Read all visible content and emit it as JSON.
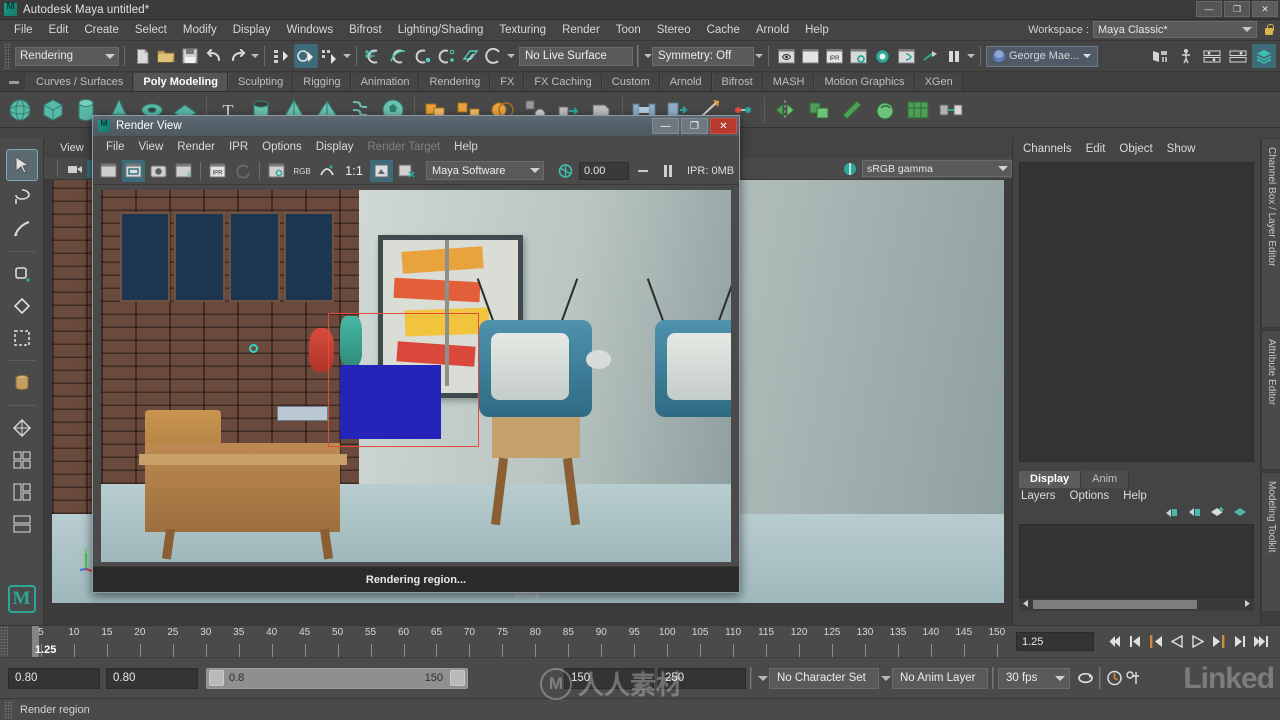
{
  "titlebar": {
    "app_title": "Autodesk Maya  untitled*",
    "logo_icon": "maya-logo-icon",
    "minimize": "—",
    "maximize": "❐",
    "close": "✕"
  },
  "menubar": {
    "items": [
      {
        "label": "File"
      },
      {
        "label": "Edit"
      },
      {
        "label": "Create"
      },
      {
        "label": "Select"
      },
      {
        "label": "Modify"
      },
      {
        "label": "Display"
      },
      {
        "label": "Windows"
      },
      {
        "label": "Bifrost"
      },
      {
        "label": "Lighting/Shading"
      },
      {
        "label": "Texturing"
      },
      {
        "label": "Render"
      },
      {
        "label": "Toon"
      },
      {
        "label": "Stereo"
      },
      {
        "label": "Cache"
      },
      {
        "label": "Arnold"
      },
      {
        "label": "Help"
      }
    ],
    "workspace_label": "Workspace :",
    "workspace_value": "Maya Classic*",
    "lock_icon": "lock-icon"
  },
  "statusbar": {
    "menuset_value": "Rendering",
    "live_surface": "No Live Surface",
    "symmetry": "Symmetry: Off",
    "user_name": "George Mae...",
    "icons": [
      "new-scene-icon",
      "open-scene-icon",
      "save-scene-icon",
      "undo-icon",
      "redo-icon",
      "select-by-hierarchy-icon",
      "select-by-object-icon",
      "select-by-component-icon",
      "snap-to-grid-icon",
      "snap-to-curve-icon",
      "snap-to-point-icon",
      "snap-to-projected-center-icon",
      "snap-to-view-plane-icon",
      "make-live-icon",
      "render-current-frame-icon",
      "render-sequence-icon",
      "ipr-render-icon",
      "render-settings-icon",
      "hypershade-icon",
      "render-setup-icon",
      "light-icon",
      "pause-icon",
      "show-hide-editors-icon",
      "attribute-editor-icon",
      "tool-settings-icon",
      "channel-box-icon"
    ]
  },
  "shelf": {
    "tabs": [
      {
        "label": "Curves / Surfaces",
        "active": false
      },
      {
        "label": "Poly Modeling",
        "active": true
      },
      {
        "label": "Sculpting",
        "active": false
      },
      {
        "label": "Rigging",
        "active": false
      },
      {
        "label": "Animation",
        "active": false
      },
      {
        "label": "Rendering",
        "active": false
      },
      {
        "label": "FX",
        "active": false
      },
      {
        "label": "FX Caching",
        "active": false
      },
      {
        "label": "Custom",
        "active": false
      },
      {
        "label": "Arnold",
        "active": false
      },
      {
        "label": "Bifrost",
        "active": false
      },
      {
        "label": "MASH",
        "active": false
      },
      {
        "label": "Motion Graphics",
        "active": false
      },
      {
        "label": "XGen",
        "active": false
      }
    ],
    "icon_names": [
      "poly-sphere-icon",
      "poly-cube-icon",
      "poly-cylinder-icon",
      "poly-cone-icon",
      "poly-torus-icon",
      "poly-plane-icon",
      "poly-text-icon",
      "poly-pipe-icon",
      "poly-prism-icon",
      "poly-pyramid-icon",
      "poly-helix-icon",
      "poly-soccer-ball-icon",
      "combine-icon",
      "separate-icon",
      "boolean-icon",
      "smooth-icon",
      "extrude-icon",
      "bevel-icon",
      "bridge-icon",
      "append-icon",
      "multi-cut-icon",
      "target-weld-icon",
      "mirror-icon",
      "duplicate-face-icon",
      "quad-draw-icon",
      "sculpt-icon",
      "uv-editor-icon",
      "transfer-attributes-icon"
    ]
  },
  "toolbox": {
    "items": [
      {
        "name": "select-tool",
        "selected": true
      },
      {
        "name": "lasso-tool",
        "selected": false
      },
      {
        "name": "paint-select-tool",
        "selected": false
      },
      {
        "name": "move-tool",
        "selected": false
      },
      {
        "name": "rotate-tool",
        "selected": false
      },
      {
        "name": "scale-tool",
        "selected": false
      },
      {
        "name": "last-tool",
        "selected": false
      },
      {
        "name": "snap-axis-tool",
        "selected": false
      },
      {
        "name": "layout-four-view",
        "selected": false
      },
      {
        "name": "layout-persp-outliner",
        "selected": false
      },
      {
        "name": "layout-single-persp",
        "selected": false
      },
      {
        "name": "layout-hypergraph",
        "selected": false
      }
    ],
    "logo": "M"
  },
  "viewport": {
    "menu": [
      "View"
    ],
    "camera_icon": "camera-icon",
    "lock_camera_icon": "lock-camera-icon",
    "gamma_value": "sRGB gamma",
    "camera_label": "persp"
  },
  "right_panel": {
    "channel_menu": [
      "Channels",
      "Edit",
      "Object",
      "Show"
    ],
    "layer_tabs": [
      {
        "label": "Display",
        "active": true
      },
      {
        "label": "Anim",
        "active": false
      }
    ],
    "layer_menu": [
      "Layers",
      "Options",
      "Help"
    ],
    "layer_icons": [
      "move-layer-up-icon",
      "move-layer-down-icon",
      "new-layer-icon",
      "new-layer-from-selected-icon"
    ],
    "vertical_tabs": [
      "Channel Box / Layer Editor",
      "Attribute Editor",
      "Modeling Toolkit"
    ]
  },
  "timeline": {
    "current_frame": "1.25",
    "current_frame_field": "1.25",
    "ticks": [
      5,
      10,
      15,
      20,
      25,
      30,
      35,
      40,
      45,
      50,
      55,
      60,
      65,
      70,
      75,
      80,
      85,
      90,
      95,
      100,
      105,
      110,
      115,
      120,
      125,
      130,
      135,
      140,
      145,
      150
    ],
    "playback_buttons": [
      "go-to-start-icon",
      "step-back-keyframe-icon",
      "step-back-frame-icon",
      "play-backwards-icon",
      "play-forwards-icon",
      "step-forward-frame-icon",
      "step-forward-keyframe-icon",
      "go-to-end-icon"
    ]
  },
  "range": {
    "anim_start": "0.80",
    "range_start": "0.80",
    "slider_min": "0.8",
    "slider_max": "150",
    "range_end": "150",
    "anim_end": "250",
    "character_set": "No Character Set",
    "anim_layer": "No Anim Layer",
    "fps": "30 fps",
    "auto_key_icon": "auto-keyframe-icon",
    "loop_icon": "playback-loop-icon",
    "anim_prefs_icon": "animation-preferences-icon"
  },
  "command_line": {
    "text": "Render region"
  },
  "render_view": {
    "window_title": "Render View",
    "logo_icon": "maya-logo-icon",
    "window_buttons": {
      "minimize": "—",
      "maximize": "❐",
      "close": "✕"
    },
    "menu": [
      {
        "label": "File",
        "dim": false
      },
      {
        "label": "View",
        "dim": false
      },
      {
        "label": "Render",
        "dim": false
      },
      {
        "label": "IPR",
        "dim": false
      },
      {
        "label": "Options",
        "dim": false
      },
      {
        "label": "Display",
        "dim": false
      },
      {
        "label": "Render Target",
        "dim": true
      },
      {
        "label": "Help",
        "dim": false
      }
    ],
    "toolbar_icons": [
      {
        "name": "redo-previous-render-icon",
        "on": false
      },
      {
        "name": "render-region-icon",
        "on": true
      },
      {
        "name": "snapshot-icon",
        "on": false
      },
      {
        "name": "render-selected-objects-icon",
        "on": false
      },
      {
        "name": "ipr-render-icon",
        "on": false
      },
      {
        "name": "refresh-ipr-image-icon",
        "on": false,
        "dim": true
      },
      {
        "name": "ipr-render-region-icon",
        "on": false
      },
      {
        "name": "rgb-channels-icon",
        "on": false
      },
      {
        "name": "alpha-channel-icon",
        "on": false
      },
      {
        "name": "zoom-1-to-1-label",
        "on": false
      },
      {
        "name": "keep-image-icon",
        "on": true
      },
      {
        "name": "remove-image-icon",
        "on": false
      }
    ],
    "zoom_ratio": "1:1",
    "renderer": "Maya Software",
    "exposure_icon": "exposure-icon",
    "exposure_value": "0.00",
    "gamma_icon": "gamma-icon",
    "pause_icon": "pause-ipr-icon",
    "ipr_memory": "IPR: 0MB",
    "status_text": "Rendering region..."
  },
  "watermarks": {
    "chinese_text": "人人素材",
    "linkedin_text": "Linked"
  },
  "colors": {
    "window_bg": "#444444",
    "panel_bg": "#4a4a4a",
    "dark_field": "#343434",
    "accent_teal": "#2ba898",
    "highlight_blue": "#3e6b7a",
    "render_title": "#5d6a73",
    "close_red": "#b8392e",
    "region_red": "#e24c3a"
  }
}
